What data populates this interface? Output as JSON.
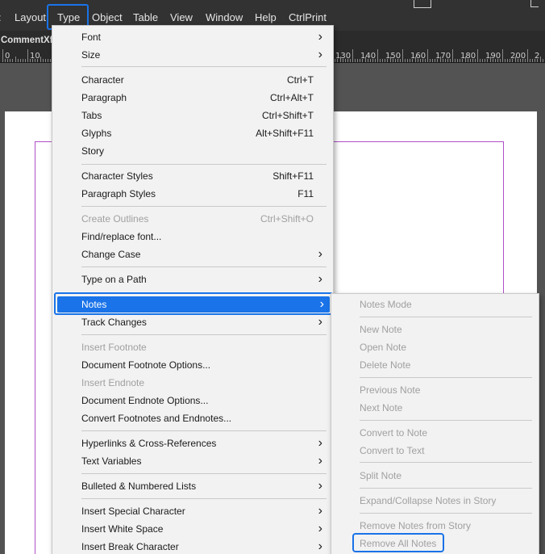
{
  "menubar": {
    "items": [
      "Layout",
      "Type",
      "Object",
      "Table",
      "View",
      "Window",
      "Help",
      "CtrlPrint"
    ]
  },
  "document_tab": "CommentXfr",
  "ruler": {
    "labels": [
      "0",
      "10",
      "130",
      "140",
      "150",
      "160",
      "170",
      "180",
      "190",
      "200",
      "2"
    ]
  },
  "type_menu": {
    "items": [
      {
        "label": "Font",
        "shortcut": "",
        "submenu": true,
        "disabled": false
      },
      {
        "label": "Size",
        "shortcut": "",
        "submenu": true,
        "disabled": false
      },
      {
        "label": "Character",
        "shortcut": "Ctrl+T",
        "submenu": false,
        "disabled": false
      },
      {
        "label": "Paragraph",
        "shortcut": "Ctrl+Alt+T",
        "submenu": false,
        "disabled": false
      },
      {
        "label": "Tabs",
        "shortcut": "Ctrl+Shift+T",
        "submenu": false,
        "disabled": false
      },
      {
        "label": "Glyphs",
        "shortcut": "Alt+Shift+F11",
        "submenu": false,
        "disabled": false
      },
      {
        "label": "Story",
        "shortcut": "",
        "submenu": false,
        "disabled": false
      },
      {
        "label": "Character Styles",
        "shortcut": "Shift+F11",
        "submenu": false,
        "disabled": false
      },
      {
        "label": "Paragraph Styles",
        "shortcut": "F11",
        "submenu": false,
        "disabled": false
      },
      {
        "label": "Create Outlines",
        "shortcut": "Ctrl+Shift+O",
        "submenu": false,
        "disabled": true
      },
      {
        "label": "Find/replace font...",
        "shortcut": "",
        "submenu": false,
        "disabled": false
      },
      {
        "label": "Change Case",
        "shortcut": "",
        "submenu": true,
        "disabled": false
      },
      {
        "label": "Type on a Path",
        "shortcut": "",
        "submenu": true,
        "disabled": false
      },
      {
        "label": "Notes",
        "shortcut": "",
        "submenu": true,
        "disabled": false,
        "highlighted": true
      },
      {
        "label": "Track Changes",
        "shortcut": "",
        "submenu": true,
        "disabled": false
      },
      {
        "label": "Insert Footnote",
        "shortcut": "",
        "submenu": false,
        "disabled": true
      },
      {
        "label": "Document Footnote Options...",
        "shortcut": "",
        "submenu": false,
        "disabled": false
      },
      {
        "label": "Insert Endnote",
        "shortcut": "",
        "submenu": false,
        "disabled": true
      },
      {
        "label": "Document Endnote Options...",
        "shortcut": "",
        "submenu": false,
        "disabled": false
      },
      {
        "label": "Convert Footnotes and Endnotes...",
        "shortcut": "",
        "submenu": false,
        "disabled": false
      },
      {
        "label": "Hyperlinks & Cross-References",
        "shortcut": "",
        "submenu": true,
        "disabled": false
      },
      {
        "label": "Text Variables",
        "shortcut": "",
        "submenu": true,
        "disabled": false
      },
      {
        "label": "Bulleted & Numbered Lists",
        "shortcut": "",
        "submenu": true,
        "disabled": false
      },
      {
        "label": "Insert Special Character",
        "shortcut": "",
        "submenu": true,
        "disabled": false
      },
      {
        "label": "Insert White Space",
        "shortcut": "",
        "submenu": true,
        "disabled": false
      },
      {
        "label": "Insert Break Character",
        "shortcut": "",
        "submenu": true,
        "disabled": false
      }
    ]
  },
  "notes_submenu": {
    "items": [
      {
        "label": "Notes Mode",
        "disabled": true
      },
      {
        "label": "New Note",
        "disabled": true
      },
      {
        "label": "Open Note",
        "disabled": true
      },
      {
        "label": "Delete Note",
        "disabled": true
      },
      {
        "label": "Previous Note",
        "disabled": true
      },
      {
        "label": "Next Note",
        "disabled": true
      },
      {
        "label": "Convert to Note",
        "disabled": true
      },
      {
        "label": "Convert to Text",
        "disabled": true
      },
      {
        "label": "Split Note",
        "disabled": true
      },
      {
        "label": "Expand/Collapse Notes in Story",
        "disabled": true
      },
      {
        "label": "Remove Notes from Story",
        "disabled": true
      },
      {
        "label": "Remove All Notes",
        "disabled": true
      }
    ]
  },
  "icons": {
    "submenu_arrow": "chevron-right-icon"
  },
  "colors": {
    "highlight": "#1a73e8",
    "margin_guide": "#b04fc8"
  }
}
